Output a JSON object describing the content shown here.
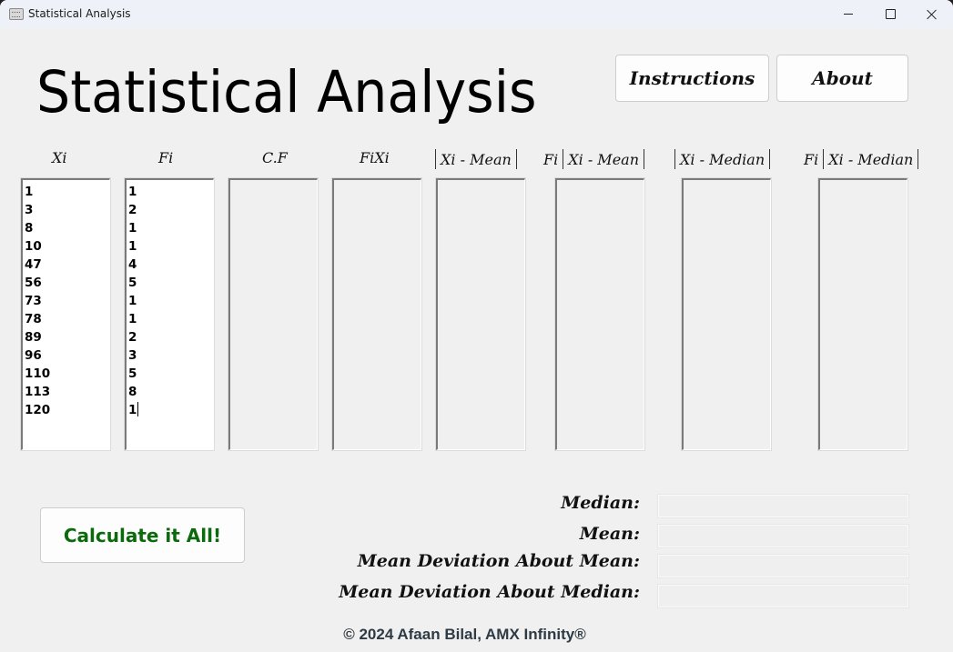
{
  "window": {
    "title": "Statistical Analysis",
    "controls": {
      "minimize": "minimize",
      "maximize": "maximize",
      "close": "close"
    }
  },
  "header": {
    "title": "Statistical Analysis",
    "instructions_label": "Instructions",
    "about_label": "About"
  },
  "columns": [
    {
      "key": "xi",
      "header": "Xi",
      "editable": true,
      "values": [
        "1",
        "3",
        "8",
        "10",
        "47",
        "56",
        "73",
        "78",
        "89",
        "96",
        "110",
        "113",
        "120"
      ]
    },
    {
      "key": "fi",
      "header": "Fi",
      "editable": true,
      "values": [
        "1",
        "2",
        "1",
        "1",
        "4",
        "5",
        "1",
        "1",
        "2",
        "3",
        "5",
        "8",
        "1"
      ]
    },
    {
      "key": "cf",
      "header": "C.F",
      "editable": false,
      "values": []
    },
    {
      "key": "fixi",
      "header": "FiXi",
      "editable": false,
      "values": []
    },
    {
      "key": "abs_xi_mean",
      "header": "Xi - Mean",
      "editable": false,
      "values": []
    },
    {
      "key": "fi_abs_xi_mean",
      "header_prefix": "Fi",
      "header": "Xi - Mean",
      "editable": false,
      "values": []
    },
    {
      "key": "abs_xi_median",
      "header": "Xi - Median",
      "editable": false,
      "values": []
    },
    {
      "key": "fi_abs_xi_median",
      "header_prefix": "Fi",
      "header": "Xi - Median",
      "editable": false,
      "values": []
    }
  ],
  "actions": {
    "calculate_label": "Calculate it All!"
  },
  "results": [
    {
      "label": "Median:",
      "value": ""
    },
    {
      "label": "Mean:",
      "value": ""
    },
    {
      "label": "Mean Deviation About Mean:",
      "value": ""
    },
    {
      "label": "Mean Deviation About Median:",
      "value": ""
    }
  ],
  "colors": {
    "calculate_text": "#0b6a0b",
    "background": "#f0f0f0"
  },
  "footer": {
    "text": "© 2024 Afaan Bilal, AMX Infinity®"
  }
}
